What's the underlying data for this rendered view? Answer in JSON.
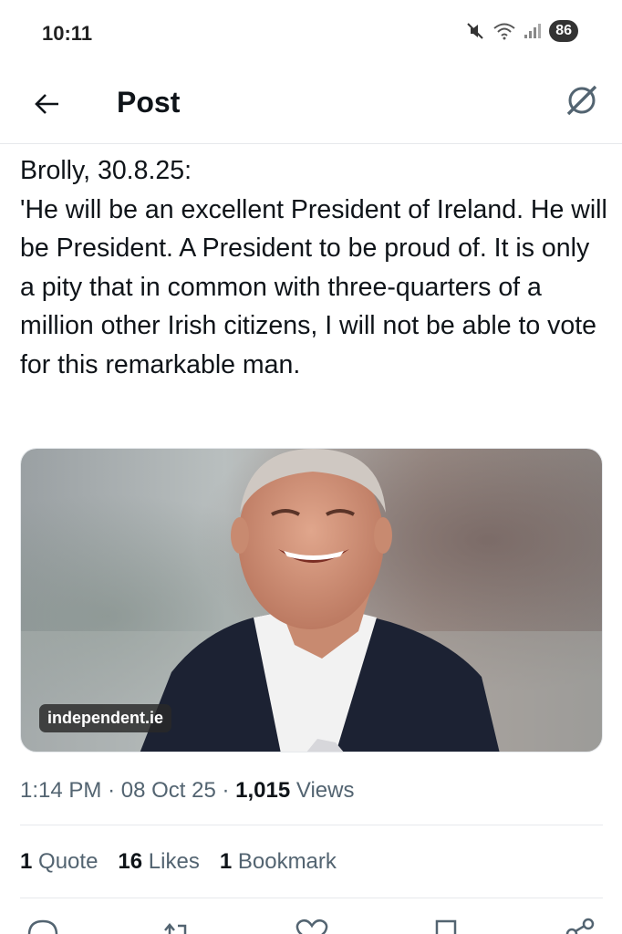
{
  "status_bar": {
    "time": "10:11",
    "battery": "86",
    "icons": [
      "mute-icon",
      "wifi-icon",
      "signal-icon"
    ]
  },
  "header": {
    "title": "Post",
    "back_icon": "arrow-left-icon",
    "grok_icon": "grok-icon"
  },
  "post": {
    "text": "Brolly, 30.8.25:\n'He will be an excellent President of Ireland. He will be President. A President to be proud of. It is only a pity that in common with three-quarters of a million other Irish citizens, I will not be able to vote for this remarkable man.",
    "media_source": "independent.ie",
    "time": "1:14 PM",
    "date": "08 Oct 25",
    "views_count": "1,015",
    "views_label": "Views"
  },
  "stats": {
    "quotes_count": "1",
    "quotes_label": "Quote",
    "likes_count": "16",
    "likes_label": "Likes",
    "bookmarks_count": "1",
    "bookmarks_label": "Bookmark"
  },
  "actions": [
    "reply-icon",
    "repost-icon",
    "like-icon",
    "bookmark-icon",
    "share-icon"
  ],
  "colors": {
    "text": "#0f1419",
    "secondary": "#536471",
    "divider": "#e6e9ec"
  }
}
